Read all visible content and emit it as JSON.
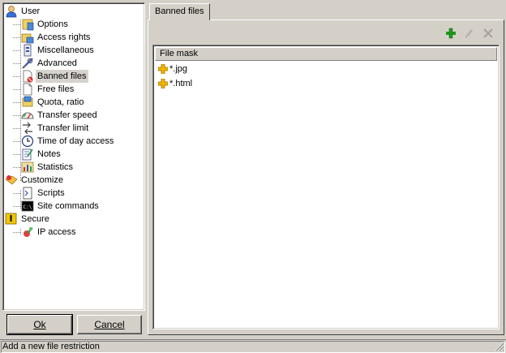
{
  "tree": {
    "items": [
      {
        "label": "User",
        "icon": "user-icon",
        "level": 0
      },
      {
        "label": "Options",
        "icon": "options-icon",
        "level": 1
      },
      {
        "label": "Access rights",
        "icon": "access-rights-icon",
        "level": 1
      },
      {
        "label": "Miscellaneous",
        "icon": "miscellaneous-icon",
        "level": 1
      },
      {
        "label": "Advanced",
        "icon": "advanced-icon",
        "level": 1
      },
      {
        "label": "Banned files",
        "icon": "banned-files-icon",
        "level": 1,
        "selected": true
      },
      {
        "label": "Free files",
        "icon": "free-files-icon",
        "level": 1
      },
      {
        "label": "Quota, ratio",
        "icon": "quota-icon",
        "level": 1
      },
      {
        "label": "Transfer speed",
        "icon": "speedometer-icon",
        "level": 1
      },
      {
        "label": "Transfer limit",
        "icon": "transfer-limit-icon",
        "level": 1
      },
      {
        "label": "Time of day access",
        "icon": "clock-icon",
        "level": 1
      },
      {
        "label": "Notes",
        "icon": "notes-icon",
        "level": 1
      },
      {
        "label": "Statistics",
        "icon": "statistics-icon",
        "level": 1
      },
      {
        "label": "Customize",
        "icon": "customize-icon",
        "level": 0
      },
      {
        "label": "Scripts",
        "icon": "scripts-icon",
        "level": 1
      },
      {
        "label": "Site commands",
        "icon": "site-commands-icon",
        "level": 1
      },
      {
        "label": "Secure",
        "icon": "secure-icon",
        "level": 0
      },
      {
        "label": "IP access",
        "icon": "ip-access-icon",
        "level": 1
      }
    ]
  },
  "buttons": {
    "ok_label": "Ok",
    "cancel_label": "Cancel"
  },
  "tab": {
    "label": "Banned files"
  },
  "toolbar": {
    "add_icon": "add-icon",
    "edit_icon": "edit-icon",
    "delete_icon": "delete-icon"
  },
  "list": {
    "header": "File mask",
    "rows": [
      {
        "mask": "*.jpg"
      },
      {
        "mask": "*.html"
      }
    ]
  },
  "status": {
    "text": "Add a new file restriction"
  },
  "colors": {
    "accent_plus": "#f0b400",
    "add_green": "#1e9a1e",
    "face": "#d4d0c8"
  }
}
